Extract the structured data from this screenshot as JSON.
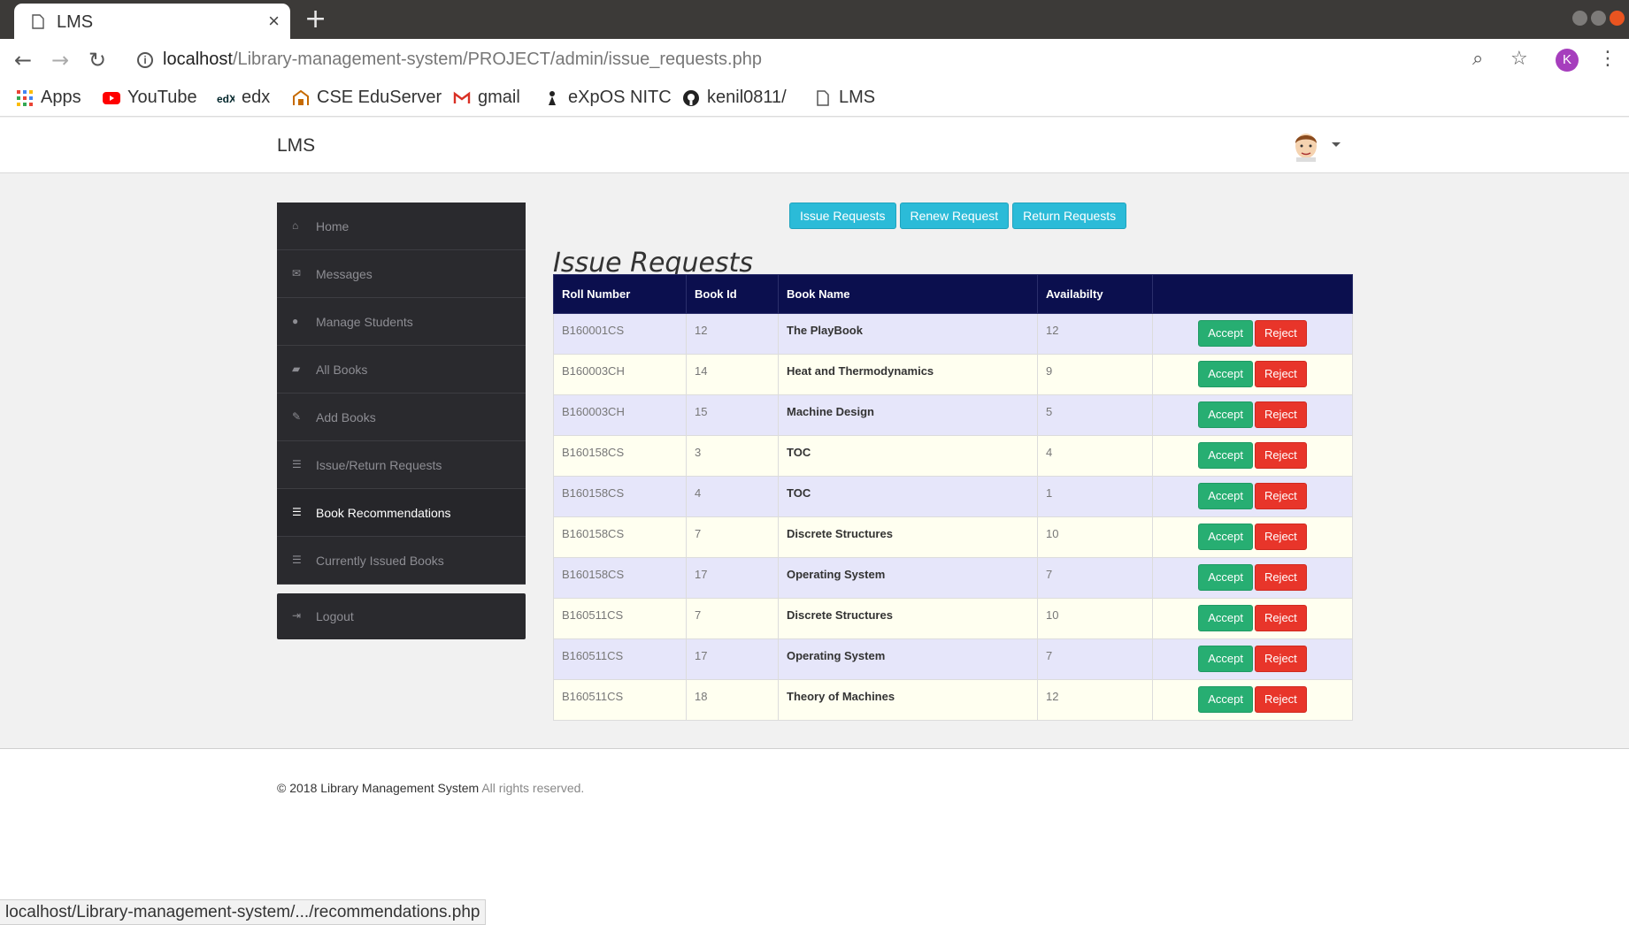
{
  "browser": {
    "tab_title": "LMS",
    "tab_close": "×",
    "new_tab": "+",
    "url_host": "localhost",
    "url_path": "/Library-management-system/PROJECT/admin/issue_requests.php",
    "profile_initial": "K",
    "bookmarks": [
      {
        "label": "Apps",
        "icon": "apps-grid-icon"
      },
      {
        "label": "YouTube",
        "icon": "youtube-icon"
      },
      {
        "label": "edx",
        "icon": "edx-icon"
      },
      {
        "label": "CSE EduServer",
        "icon": "eduserver-icon"
      },
      {
        "label": "gmail",
        "icon": "gmail-icon"
      },
      {
        "label": "eXpOS NITC",
        "icon": "expos-icon"
      },
      {
        "label": "kenil0811/",
        "icon": "github-icon"
      },
      {
        "label": "LMS",
        "icon": "page-icon"
      }
    ],
    "status_url": "localhost/Library-management-system/.../recommendations.php"
  },
  "navbar": {
    "brand": "LMS"
  },
  "sidebar": {
    "items": [
      {
        "label": "Home",
        "icon": "home-icon"
      },
      {
        "label": "Messages",
        "icon": "inbox-icon"
      },
      {
        "label": "Manage Students",
        "icon": "user-icon"
      },
      {
        "label": "All Books",
        "icon": "book-icon"
      },
      {
        "label": "Add Books",
        "icon": "edit-icon"
      },
      {
        "label": "Issue/Return Requests",
        "icon": "list-alt-icon"
      },
      {
        "label": "Book Recommendations",
        "icon": "list-icon"
      },
      {
        "label": "Currently Issued Books",
        "icon": "list-icon"
      }
    ],
    "logout": "Logout"
  },
  "subnav": {
    "issue": "Issue Requests",
    "renew": "Renew Request",
    "return": "Return Requests"
  },
  "page": {
    "title": "Issue Requests"
  },
  "table": {
    "headers": [
      "Roll Number",
      "Book Id",
      "Book Name",
      "Availabilty",
      ""
    ],
    "accept_label": "Accept",
    "reject_label": "Reject",
    "rows": [
      [
        "B160001CS",
        "12",
        "The PlayBook",
        "12"
      ],
      [
        "B160003CH",
        "14",
        "Heat and Thermodynamics",
        "9"
      ],
      [
        "B160003CH",
        "15",
        "Machine Design",
        "5"
      ],
      [
        "B160158CS",
        "3",
        "TOC",
        "4"
      ],
      [
        "B160158CS",
        "4",
        "TOC",
        "1"
      ],
      [
        "B160158CS",
        "7",
        "Discrete Structures",
        "10"
      ],
      [
        "B160158CS",
        "17",
        "Operating System",
        "7"
      ],
      [
        "B160511CS",
        "7",
        "Discrete Structures",
        "10"
      ],
      [
        "B160511CS",
        "17",
        "Operating System",
        "7"
      ],
      [
        "B160511CS",
        "18",
        "Theory of Machines",
        "12"
      ]
    ]
  },
  "footer": {
    "copyright": "© 2018 Library Management System",
    "rights": "All rights reserved."
  },
  "colors": {
    "table_header": "#0b0f4e",
    "row_odd": "#e6e6fa",
    "row_even": "#fffff0",
    "accept": "#27ae72",
    "reject": "#e8352a",
    "info": "#2bbbd8",
    "sidebar": "#2a2a2e"
  }
}
